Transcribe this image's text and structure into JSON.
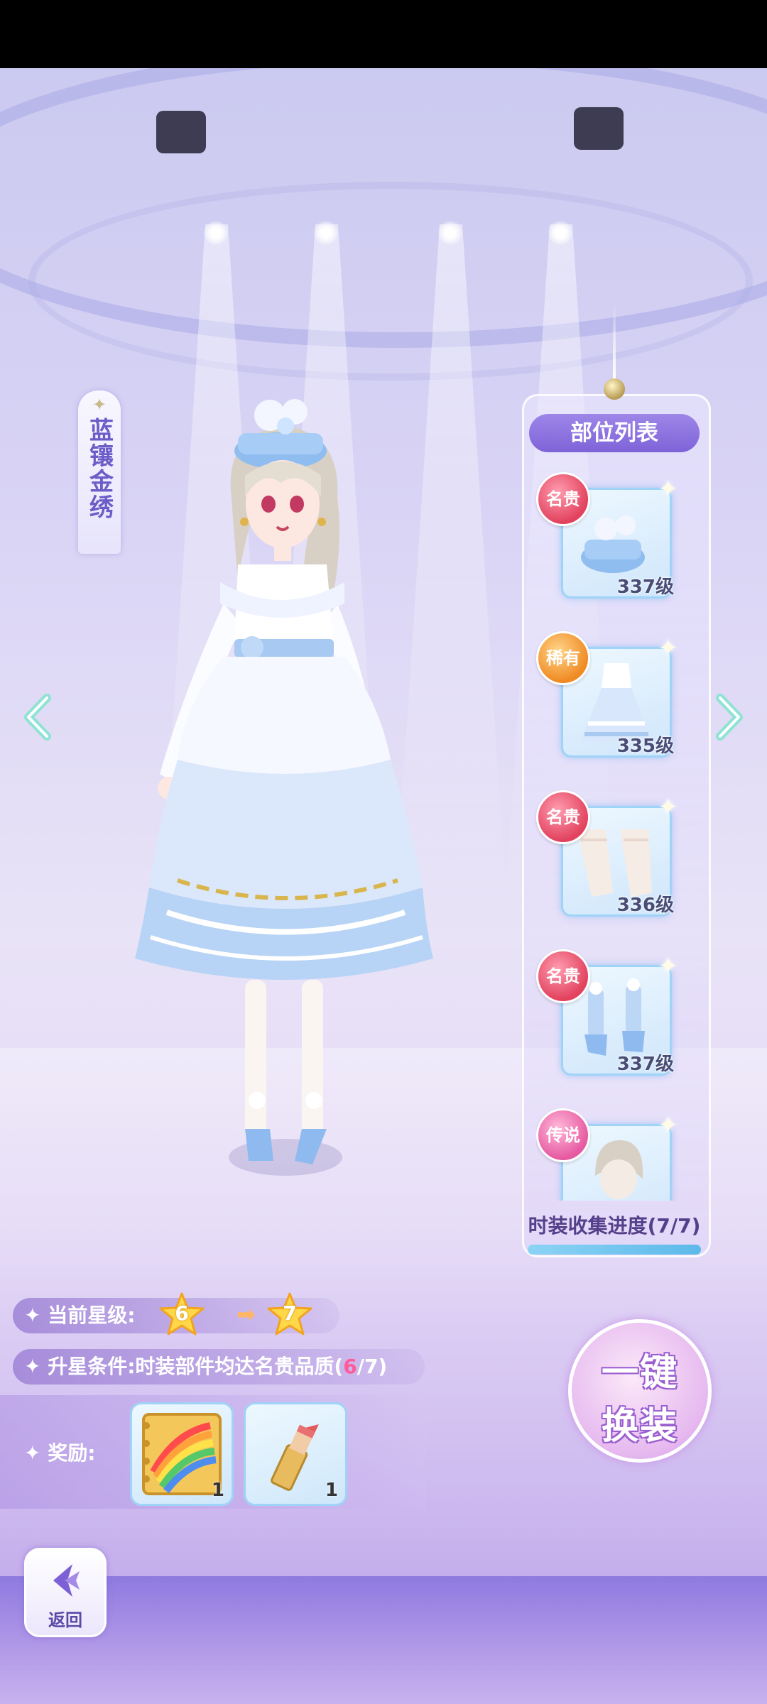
{
  "outfit": {
    "name": "蓝镶金绣"
  },
  "parts_panel": {
    "title": "部位列表",
    "items": [
      {
        "rarity": "名贵",
        "level": "337级",
        "part": "hat",
        "badge_color": "#e2425e"
      },
      {
        "rarity": "稀有",
        "level": "335级",
        "part": "dress",
        "badge_color": "#f08a23"
      },
      {
        "rarity": "名贵",
        "level": "336级",
        "part": "stockings",
        "badge_color": "#e2425e"
      },
      {
        "rarity": "名贵",
        "level": "337级",
        "part": "shoes",
        "badge_color": "#e2425e"
      },
      {
        "rarity": "传说",
        "level": "",
        "part": "hair",
        "badge_color": "#e65aa2"
      }
    ],
    "progress_label": "时装收集进度(7/7)",
    "progress": 1.0
  },
  "star_level": {
    "label": "当前星级:",
    "current": "6",
    "next": "7"
  },
  "upgrade": {
    "label": "升星条件:",
    "condition": "时装部件均达名贵品质(",
    "current": "6",
    "total": "/7)"
  },
  "rewards": {
    "label": "奖励:",
    "items": [
      {
        "icon": "rainbow-sketchbook-icon",
        "count": "1"
      },
      {
        "icon": "lipstick-icon",
        "count": "1"
      }
    ]
  },
  "onekey_button": {
    "line1": "一键",
    "line2": "换装"
  },
  "back_button": {
    "label": "返回"
  },
  "colors": {
    "accent": "#7e63d8",
    "highlight": "#ff5b9a"
  }
}
